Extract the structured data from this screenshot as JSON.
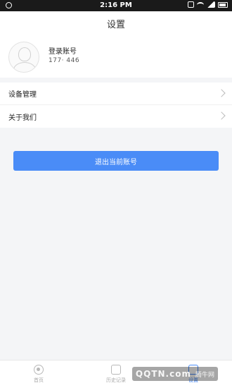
{
  "statusbar": {
    "time": "2:16 PM"
  },
  "header": {
    "title": "设置"
  },
  "profile": {
    "login_label": "登录账号",
    "phone": "177·      446"
  },
  "menu": {
    "items": [
      {
        "label": "设备管理"
      },
      {
        "label": "关于我们"
      }
    ]
  },
  "actions": {
    "logout_label": "退出当前账号"
  },
  "tabbar": {
    "tabs": [
      {
        "label": "首页"
      },
      {
        "label": "历史记录"
      },
      {
        "label": "设置"
      }
    ]
  },
  "watermark": {
    "brand": "QQTN.com",
    "text": "腾牛网"
  },
  "colors": {
    "accent": "#4a8cf7",
    "background": "#f4f5f7"
  }
}
